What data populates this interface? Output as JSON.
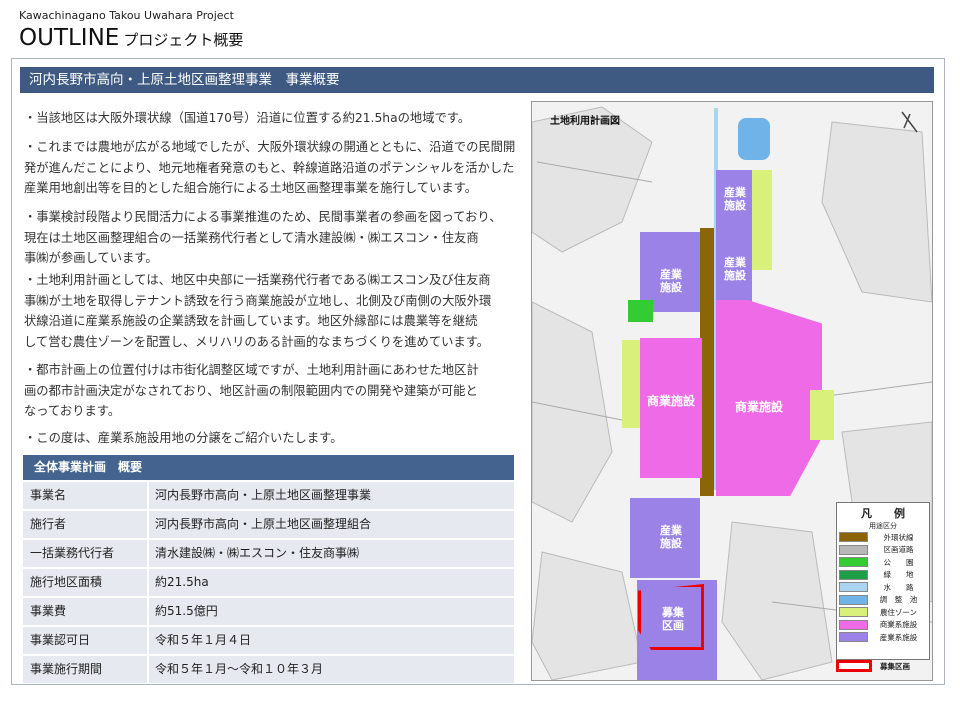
{
  "header": {
    "project": "Kawachinagano Takou Uwahara  Project",
    "outline": "OUTLINE",
    "outline_sub": "プロジェクト概要"
  },
  "section_title": "河内長野市高向・上原土地区画整理事業　事業概要",
  "paragraphs": [
    [
      "・当該地区は大阪外環状線（国道170号）沿道に位置する約21.5haの地域です。"
    ],
    [
      "・これまでは農地が広がる地域でしたが、大阪外環状線の開通とともに、沿道での民間開",
      "発が進んだことにより、地元地権者発意のもと、幹線道路沿道のポテンシャルを活かした",
      "産業用地創出等を目的とした組合施行による土地区画整理事業を施行しています。"
    ],
    [
      "・事業検討段階より民間活力による事業推進のため、民間事業者の参画を図っており、",
      "現在は土地区画整理組合の一括業務代行者として清水建設㈱・㈱エスコン・住友商",
      "事㈱が参画しています。"
    ],
    [
      "・土地利用計画としては、地区中央部に一括業務代行者である㈱エスコン及び住友商",
      "事㈱が土地を取得しテナント誘致を行う商業施設が立地し、北側及び南側の大阪外環",
      "状線沿道に産業系施設の企業誘致を計画しています。地区外縁部には農業等を継続",
      "して営む農住ゾーンを配置し、メリハリのある計画的なまちづくりを進めています。"
    ],
    [
      "・都市計画上の位置付けは市街化調整区域ですが、土地利用計画にあわせた地区計",
      "画の都市計画決定がなされており、地区計画の制限範囲内での開発や建築が可能と",
      "なっております。"
    ],
    [
      "・この度は、産業系施設用地の分譲をご紹介いたします。"
    ]
  ],
  "table": {
    "title": "全体事業計画　概要",
    "rows": [
      {
        "k": "事業名",
        "v": "河内長野市高向・上原土地区画整理事業"
      },
      {
        "k": "施行者",
        "v": "河内長野市高向・上原土地区画整理組合"
      },
      {
        "k": "一括業務代行者",
        "v": "清水建設㈱・㈱エスコン・住友商事㈱"
      },
      {
        "k": "施行地区面積",
        "v": "約21.5ha"
      },
      {
        "k": "事業費",
        "v": "約51.5億円"
      },
      {
        "k": "事業認可日",
        "v": "令和５年１月４日"
      },
      {
        "k": "事業施行期間",
        "v": "令和５年１月～令和１０年３月"
      }
    ]
  },
  "map": {
    "title": "土地利用計画図",
    "labels": {
      "sangyo": "産業施設",
      "shogyo": "商業施設",
      "boshu": "募集区画"
    },
    "legend": {
      "title": "凡　　例",
      "header": "用途区分",
      "items": [
        {
          "name": "外環状線",
          "color": "#8b6508"
        },
        {
          "name": "区画道路",
          "color": "#b8b8b8"
        },
        {
          "name": "公　　園",
          "color": "#33cc33"
        },
        {
          "name": "緑　　地",
          "color": "#1f9e4a"
        },
        {
          "name": "水　　路",
          "color": "#aad4f0"
        },
        {
          "name": "調　整　池",
          "color": "#6fb3e8"
        },
        {
          "name": "農住ゾーン",
          "color": "#d9f07a"
        },
        {
          "name": "商業系施設",
          "color": "#ee6ae6"
        },
        {
          "name": "産業系施設",
          "color": "#9b82e6"
        }
      ],
      "boshu_label": "募集区画"
    }
  }
}
